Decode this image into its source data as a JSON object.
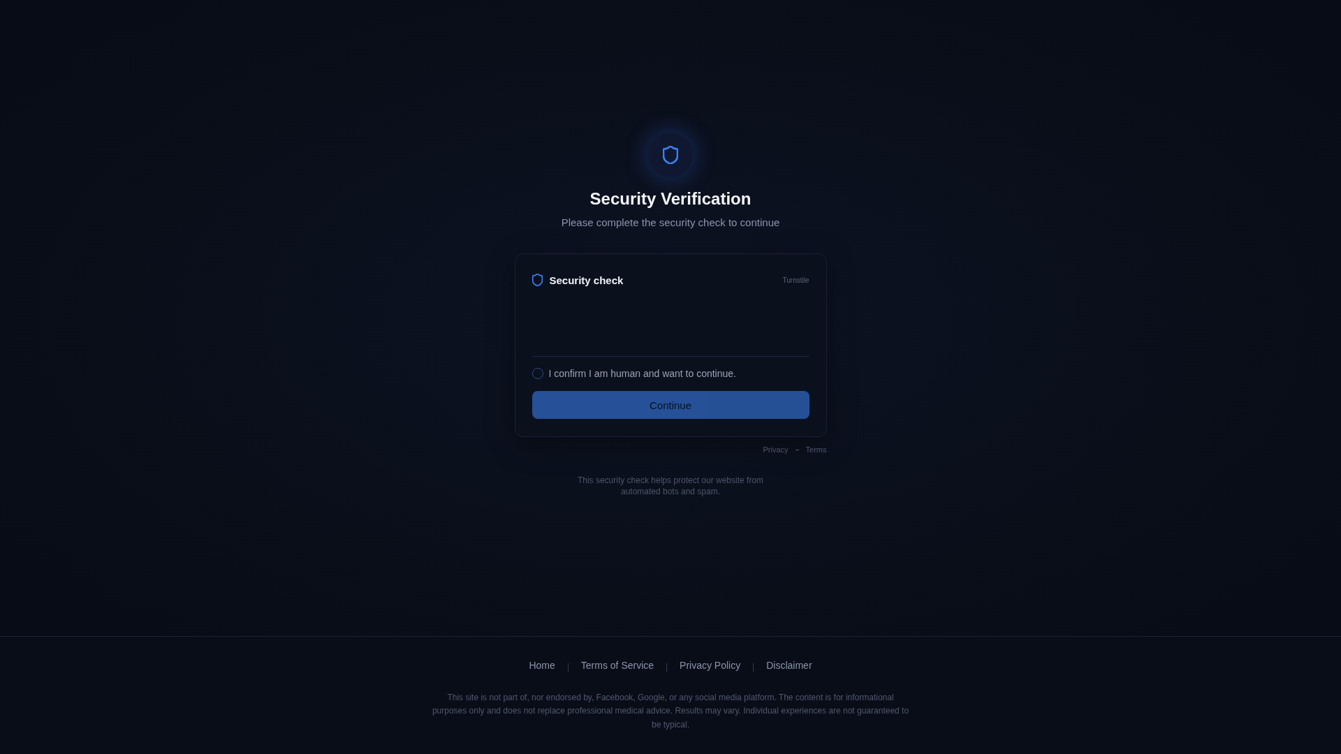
{
  "hero": {
    "title": "Security Verification",
    "subtitle": "Please complete the security check to continue"
  },
  "card": {
    "title": "Security check",
    "provider": "Turnstile",
    "confirm": {
      "label": "I confirm I am human and want to continue.",
      "checked": false
    },
    "button": {
      "label": "Continue",
      "disabled": true
    }
  },
  "legal_links": [
    "Privacy",
    "Terms"
  ],
  "note": "This security check helps protect our website from automated bots and spam.",
  "footer": {
    "links": [
      "Home",
      "Terms of Service",
      "Privacy Policy",
      "Disclaimer"
    ],
    "disclaimer": "This site is not part of, nor endorsed by, Facebook, Google, or any social media platform. The content is for informational purposes only and does not replace professional medical advice. Results may vary. Individual experiences are not guaranteed to be typical."
  }
}
